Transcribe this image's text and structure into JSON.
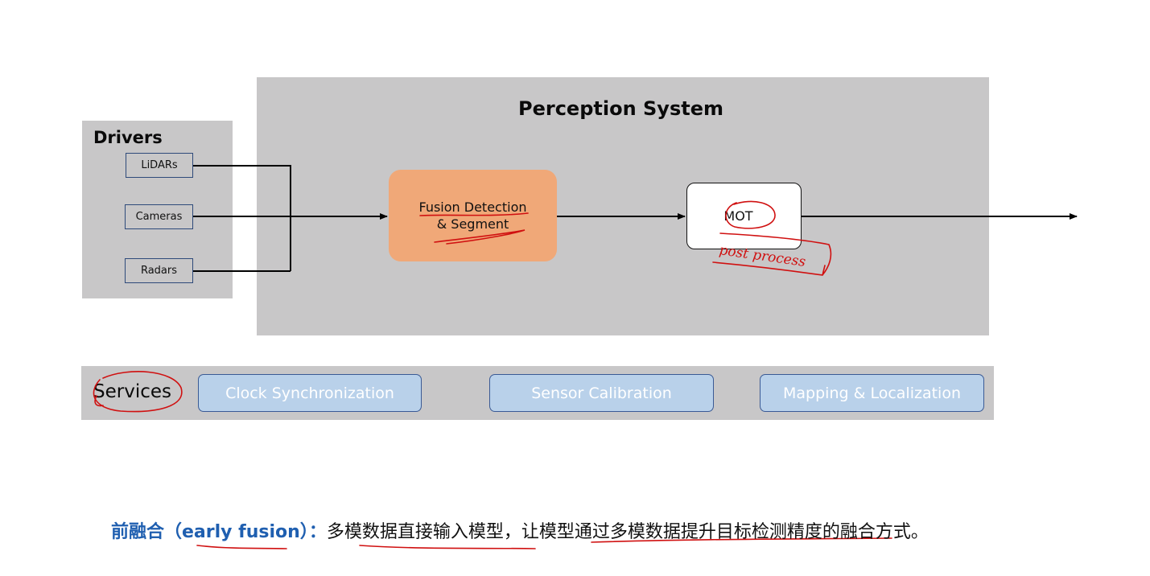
{
  "perception": {
    "title": "Perception System"
  },
  "drivers": {
    "title": "Drivers",
    "items": [
      "LiDARs",
      "Cameras",
      "Radars"
    ]
  },
  "modules": {
    "fusion_line1": "Fusion Detection",
    "fusion_line2": "& Segment",
    "mot": "MOT",
    "handwritten_note": "post process"
  },
  "services": {
    "title": "Services",
    "items": [
      "Clock Synchronization",
      "Sensor Calibration",
      "Mapping & Localization"
    ]
  },
  "caption": {
    "term": "前融合（early fusion）",
    "colon": "：",
    "text": "多模数据直接输入模型，让模型通过多模数据提升目标检测精度的融合方式。"
  },
  "colors": {
    "panel_gray": "#c8c7c8",
    "fusion_orange": "#f0a878",
    "service_blue": "#b9d1ea",
    "caption_blue": "#1f5fb0",
    "annotation_red": "#d01010"
  }
}
